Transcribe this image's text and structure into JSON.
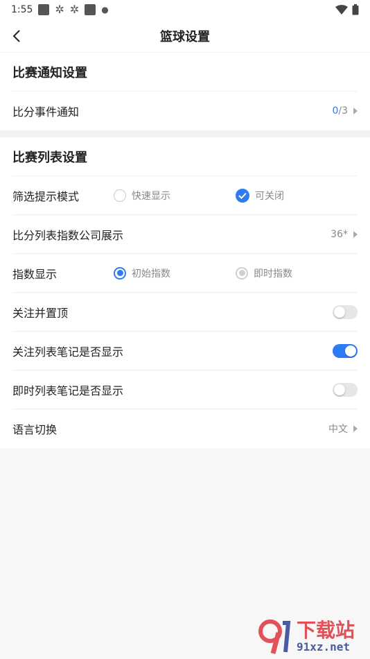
{
  "status_bar": {
    "time": "1:55"
  },
  "nav": {
    "title": "篮球设置"
  },
  "section1": {
    "title": "比赛通知设置",
    "row": {
      "label": "比分事件通知",
      "value_current": "0",
      "value_total": "/3"
    }
  },
  "section2": {
    "title": "比赛列表设置",
    "filter": {
      "label": "筛选提示模式",
      "option1": "快速显示",
      "option2": "可关闭",
      "selected": "可关闭"
    },
    "company": {
      "label": "比分列表指数公司展示",
      "value": "36*"
    },
    "index": {
      "label": "指数显示",
      "option1": "初始指数",
      "option2": "即时指数",
      "selected": "初始指数"
    },
    "follow_top": {
      "label": "关注并置顶",
      "on": false
    },
    "follow_notes": {
      "label": "关注列表笔记是否显示",
      "on": true
    },
    "live_notes": {
      "label": "即时列表笔记是否显示",
      "on": false
    },
    "language": {
      "label": "语言切换",
      "value": "中文"
    }
  },
  "colors": {
    "accent": "#2d7cf5"
  },
  "watermark": {
    "text_cn": "下载站",
    "text_en": "91xz.net"
  }
}
